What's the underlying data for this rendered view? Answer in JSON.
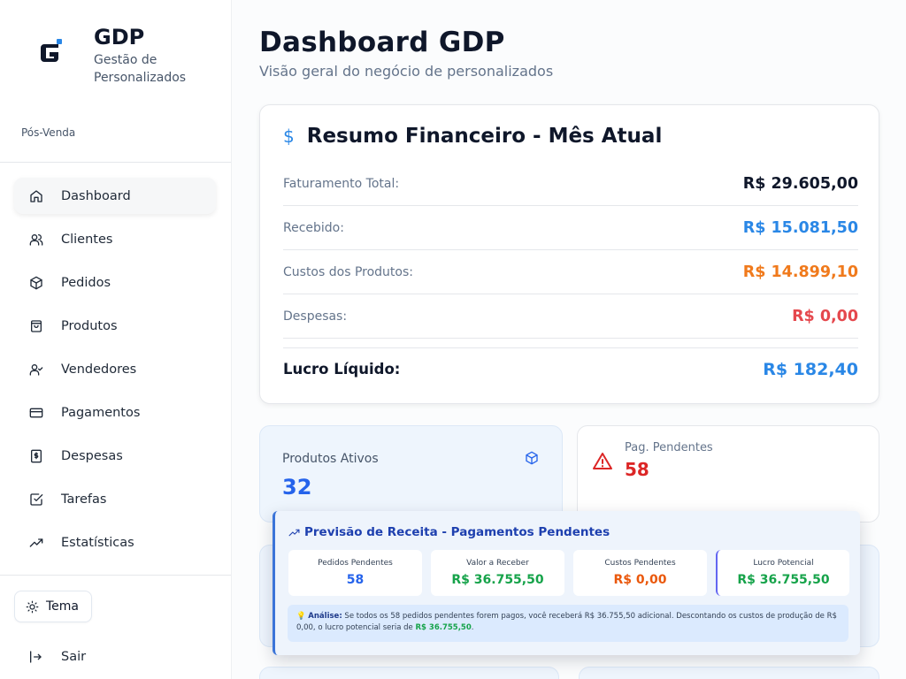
{
  "brand": {
    "title": "GDP",
    "subtitle": "Gestão de Personalizados"
  },
  "sidebar": {
    "section_label": "Pós-Venda",
    "items": [
      {
        "label": "Dashboard",
        "icon": "home-icon",
        "active": true
      },
      {
        "label": "Clientes",
        "icon": "users-icon"
      },
      {
        "label": "Pedidos",
        "icon": "package-icon"
      },
      {
        "label": "Produtos",
        "icon": "shopping-bag-icon"
      },
      {
        "label": "Vendedores",
        "icon": "user-check-icon"
      },
      {
        "label": "Pagamentos",
        "icon": "credit-card-icon"
      },
      {
        "label": "Despesas",
        "icon": "receipt-icon"
      },
      {
        "label": "Tarefas",
        "icon": "check-square-icon"
      },
      {
        "label": "Estatísticas",
        "icon": "trending-up-icon"
      }
    ],
    "theme_label": "Tema",
    "logout_label": "Sair"
  },
  "header": {
    "title": "Dashboard GDP",
    "subtitle": "Visão geral do negócio de personalizados"
  },
  "financial": {
    "icon": "$",
    "title": "Resumo Financeiro - Mês Atual",
    "rows": [
      {
        "label": "Faturamento Total:",
        "value": "R$ 29.605,00",
        "color": "#0f172a"
      },
      {
        "label": "Recebido:",
        "value": "R$ 15.081,50",
        "color": "#2a87e6"
      },
      {
        "label": "Custos dos Produtos:",
        "value": "R$ 14.899,10",
        "color": "#f07a1c"
      },
      {
        "label": "Despesas:",
        "value": "R$ 0,00",
        "color": "#e5484d"
      }
    ],
    "net_label": "Lucro Líquido:",
    "net_value": "R$ 182,40"
  },
  "stats": {
    "active_products": {
      "label": "Produtos Ativos",
      "value": "32"
    },
    "pending_payments": {
      "label": "Pag. Pendentes",
      "value": "58"
    }
  },
  "forecast": {
    "title": "Previsão de Receita - Pagamentos Pendentes",
    "boxes": [
      {
        "label": "Pedidos Pendentes",
        "value": "58",
        "color": "#2563eb"
      },
      {
        "label": "Valor a Receber",
        "value": "R$ 36.755,50",
        "color": "#16a34a"
      },
      {
        "label": "Custos Pendentes",
        "value": "R$ 0,00",
        "color": "#ea580c"
      },
      {
        "label": "Lucro Potencial",
        "value": "R$ 36.755,50",
        "color": "#16a34a"
      }
    ],
    "note_icon": "💡",
    "note_label": "Análise:",
    "note_text": "Se todos os 58 pedidos pendentes forem pagos, você receberá R$ 36.755,50 adicional. Descontando os custos de produção de R$ 0,00, o lucro potencial seria de",
    "note_value": "R$ 36.755,50",
    "note_end": "."
  }
}
